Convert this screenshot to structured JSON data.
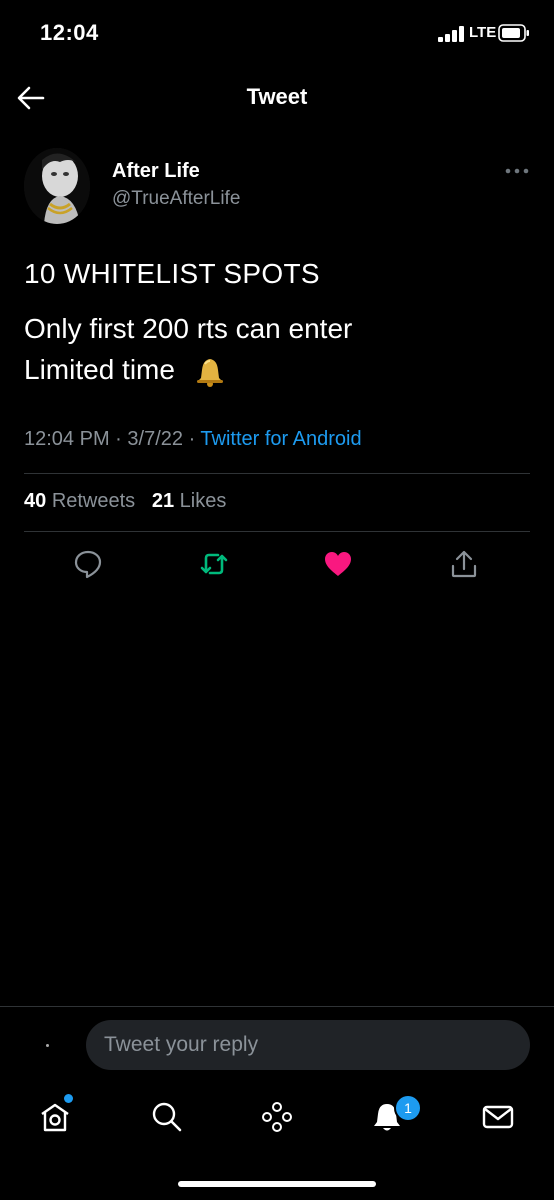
{
  "status_bar": {
    "time": "12:04",
    "network": "LTE"
  },
  "header": {
    "title": "Tweet"
  },
  "author": {
    "name": "After Life",
    "handle": "@TrueAfterLife"
  },
  "tweet": {
    "line1": "10 WHITELIST SPOTS",
    "line2": "Only first 200 rts can enter",
    "line3": "Limited time",
    "time": "12:04 PM",
    "date": "3/7/22",
    "source": "Twitter for Android"
  },
  "stats": {
    "retweets_count": "40",
    "retweets_label": "Retweets",
    "likes_count": "21",
    "likes_label": "Likes"
  },
  "reply": {
    "placeholder": "Tweet your reply"
  },
  "nav": {
    "notifications_badge": "1"
  },
  "colors": {
    "accent": "#1d9bf0",
    "like": "#f91880",
    "retweet": "#00ba7c",
    "muted": "#8b9299"
  }
}
